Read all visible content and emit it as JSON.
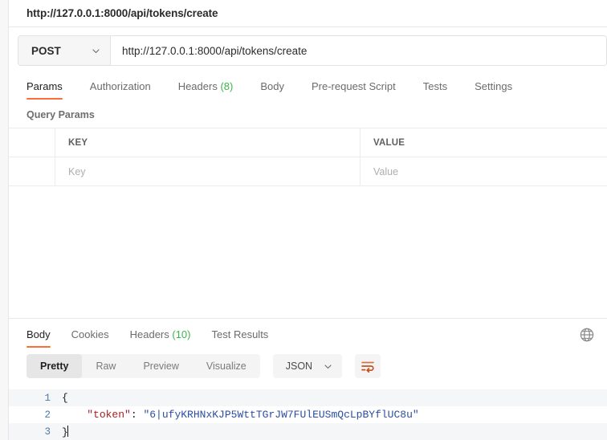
{
  "request": {
    "title": "http://127.0.0.1:8000/api/tokens/create",
    "method": "POST",
    "method_chevron": "chevron-down-icon",
    "url": "http://127.0.0.1:8000/api/tokens/create",
    "tabs": [
      {
        "label": "Params",
        "count": "",
        "active": true
      },
      {
        "label": "Authorization",
        "count": "",
        "active": false
      },
      {
        "label": "Headers",
        "count": "(8)",
        "active": false
      },
      {
        "label": "Body",
        "count": "",
        "active": false
      },
      {
        "label": "Pre-request Script",
        "count": "",
        "active": false
      },
      {
        "label": "Tests",
        "count": "",
        "active": false
      },
      {
        "label": "Settings",
        "count": "",
        "active": false
      }
    ],
    "params_section_label": "Query Params",
    "params_table": {
      "headers": [
        "",
        "KEY",
        "VALUE"
      ],
      "rows": [
        {
          "key_placeholder": "Key",
          "value_placeholder": "Value"
        }
      ]
    }
  },
  "response": {
    "tabs": [
      {
        "label": "Body",
        "count": "",
        "active": true
      },
      {
        "label": "Cookies",
        "count": "",
        "active": false
      },
      {
        "label": "Headers",
        "count": "(10)",
        "active": false
      },
      {
        "label": "Test Results",
        "count": "",
        "active": false
      }
    ],
    "globe_icon": "globe-icon",
    "format_tabs": [
      {
        "label": "Pretty",
        "active": true
      },
      {
        "label": "Raw",
        "active": false
      },
      {
        "label": "Preview",
        "active": false
      },
      {
        "label": "Visualize",
        "active": false
      }
    ],
    "language": "JSON",
    "language_chevron": "chevron-down-icon",
    "wrap_icon": "word-wrap-icon",
    "code_lines": [
      {
        "no": "1",
        "parts": [
          {
            "t": "{",
            "c": "tok-brace"
          }
        ]
      },
      {
        "no": "2",
        "parts": [
          {
            "t": "    ",
            "c": "tok-punc"
          },
          {
            "t": "\"token\"",
            "c": "tok-key"
          },
          {
            "t": ": ",
            "c": "tok-punc"
          },
          {
            "t": "\"6|ufyKRHNxKJP5WttTGrJW7FUlEUSmQcLpBYflUC8u\"",
            "c": "tok-str"
          }
        ]
      },
      {
        "no": "3",
        "parts": [
          {
            "t": "}",
            "c": "tok-brace"
          }
        ]
      }
    ]
  },
  "colors": {
    "accent": "#ff6c37",
    "count_green": "#3bb54a",
    "string_blue": "#2b4ea2",
    "key_red": "#a82020",
    "line_number": "#4a7aab"
  }
}
